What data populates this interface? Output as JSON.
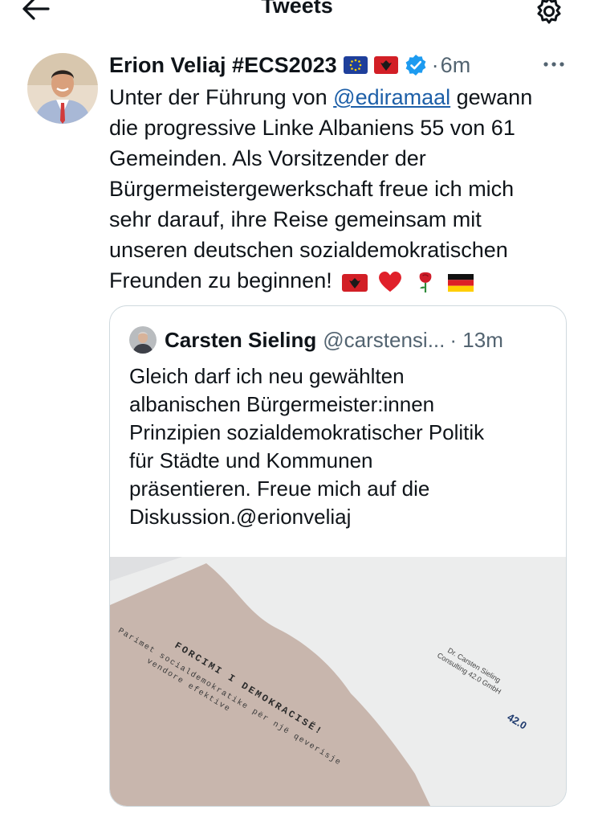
{
  "header": {
    "title": "Tweets",
    "back_icon": "arrow-left-icon",
    "settings_icon": "gear-icon"
  },
  "tweet": {
    "author_name": "Erion Veliaj #ECS2023",
    "name_emojis": [
      "eu-flag",
      "albania-flag"
    ],
    "verified_icon": "verified-badge-icon",
    "dot": "·",
    "time": "6m",
    "more_icon": "more-dots-icon",
    "text": {
      "l1_pre": "Unter der Führung von ",
      "l1_mention": "@ediramaal",
      "l1_post": " gewann",
      "l2": "die progressive Linke Albaniens 55 von 61",
      "l3": "Gemeinden. Als Vorsitzender der",
      "l4": "Bürgermeistergewerkschaft freue ich mich",
      "l5": "sehr darauf, ihre Reise gemeinsam mit",
      "l6": "unseren deutschen sozialdemokratischen",
      "l7": "Freunden zu beginnen!"
    },
    "trailing_emojis": [
      "albania-flag",
      "red-heart",
      "rose",
      "germany-flag"
    ]
  },
  "quoted_tweet": {
    "author_name": "Carsten Sieling",
    "handle": "@carstensi...",
    "time": "· 13m",
    "lines": [
      "Gleich darf ich neu gewählten",
      "albanischen Bürgermeister:innen",
      "Prinzipien sozialdemokratischer Politik",
      "für Städte und Kommunen",
      "präsentieren. Freue mich auf die",
      "Diskussion.@erionveliaj"
    ],
    "image": {
      "title": "FORCIMI I DEMOKRACISË!",
      "subtitle_1": "Parimet socialdemokratike për një qeverisje",
      "subtitle_2": "vendore efektive",
      "author_1": "Dr. Carsten Sieling",
      "author_2": "Consulting 42.0 GmbH",
      "badge": "42.0"
    }
  },
  "colors": {
    "text": "#0f1419",
    "muted": "#536471",
    "link": "#1d5fa8",
    "verified": "#1d9bf0",
    "border": "#cfd9de"
  }
}
